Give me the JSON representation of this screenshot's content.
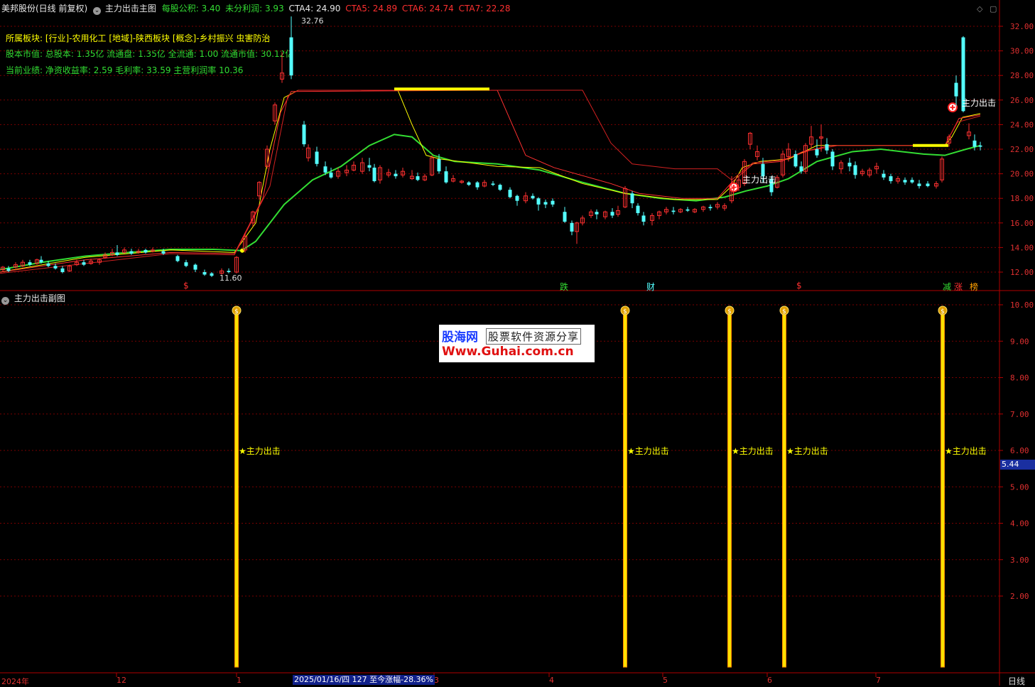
{
  "header": {
    "stock_title": "美邦股份(日线 前复权)",
    "indicator_name": "主力出击主图",
    "per_share_fund_label": "每股公积:",
    "per_share_fund_value": "3.40",
    "undistributed_label": "未分利润:",
    "undistributed_value": "3.93",
    "cta4_label": "CTA4:",
    "cta4_value": "24.90",
    "cta5_label": "CTA5:",
    "cta5_value": "24.89",
    "cta6_label": "CTA6:",
    "cta6_value": "24.74",
    "cta7_label": "CTA7:",
    "cta7_value": "22.28"
  },
  "info": {
    "sector_line": "所属板块: [行业]-农用化工 [地域]-陕西板块 [概念]-乡村振兴 虫害防治",
    "capital_line": "股本市值: 总股本: 1.35亿 流通盘: 1.35亿 全流通: 1.00 流通市值: 30.12亿",
    "performance_line": "当前业绩: 净资收益率: 2.59 毛利率: 33.59 主营利润率 10.36"
  },
  "main_chart": {
    "high_label": "32.76",
    "low_label": "11.60",
    "signal_label": "主力出击",
    "y_ticks": [
      "32.00",
      "30.00",
      "28.00",
      "26.00",
      "24.00",
      "22.00",
      "20.00",
      "18.00",
      "16.00",
      "14.00",
      "12.00"
    ],
    "markers": [
      "$",
      "跌",
      "财",
      "$",
      "减",
      "涨",
      "榜"
    ]
  },
  "sub_chart": {
    "title": "主力出击副图",
    "signal_label": "★主力出击",
    "current_value": "5.44",
    "y_ticks": [
      "10.00",
      "9.00",
      "8.00",
      "7.00",
      "6.00",
      "5.00",
      "4.00",
      "3.00",
      "2.00"
    ]
  },
  "watermark": {
    "brand": "股海网",
    "slogan": "股票软件资源分享",
    "url": "Www.Guhai.com.cn"
  },
  "x_axis": {
    "labels": [
      "2024年",
      "12",
      "1",
      "3",
      "4",
      "5",
      "6",
      "7"
    ],
    "cursor_info": "2025/01/16/四 127 至今涨幅-28.36%",
    "period": "日线"
  },
  "colors": {
    "up": "#ff3030",
    "down": "#54ffff",
    "ma_green": "#33dd33",
    "ma_yellow": "#ffff00",
    "grid": "#7a0000"
  }
}
